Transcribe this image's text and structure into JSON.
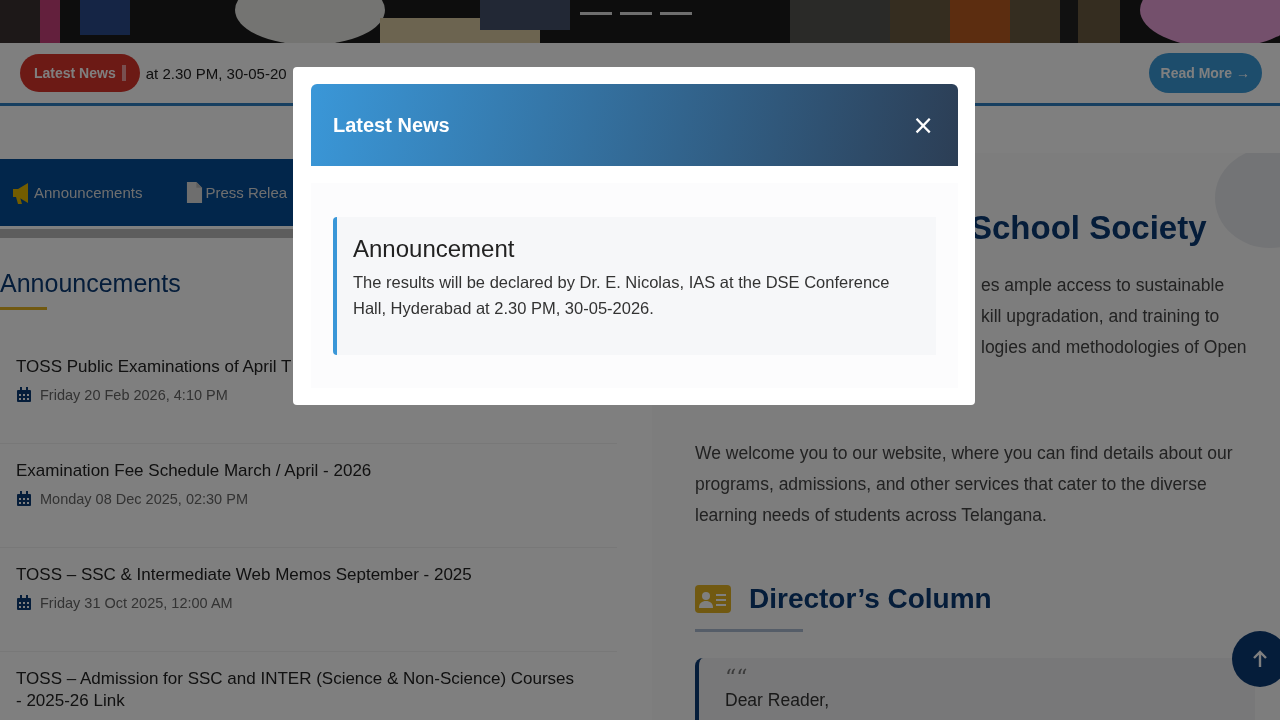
{
  "ticker": {
    "badge": "Latest News",
    "text": "at 2.30 PM, 30-05-20",
    "button": "Read More →"
  },
  "tabs": [
    {
      "label": "Announcements"
    },
    {
      "label": "Press Relea"
    }
  ],
  "announcements": {
    "heading": "Announcements",
    "items": [
      {
        "title": "TOSS Public Examinations of April T",
        "date": "Friday 20 Feb 2026, 4:10 PM"
      },
      {
        "title": "Examination Fee Schedule March / April - 2026",
        "date": "Monday 08 Dec 2025, 02:30 PM"
      },
      {
        "title": "TOSS – SSC & Intermediate Web Memos September - 2025",
        "date": "Friday 31 Oct 2025, 12:00 AM"
      },
      {
        "title": "TOSS – Admission for SSC and INTER (Science & Non-Science) Courses - 2025-26 Link"
      }
    ]
  },
  "about": {
    "heading": "School Society",
    "lines": [
      "es ample access to sustainable",
      "kill upgradation, and training to",
      "logies and methodologies of Open"
    ],
    "welcome": "We welcome you to our website, where you can find details about our programs, admissions, and other services that cater to the diverse learning needs of students across Telangana."
  },
  "director": {
    "heading": "Director’s Column",
    "quote_mark": "““",
    "greeting": "Dear Reader,"
  },
  "modal": {
    "title": "Latest News",
    "close": "×",
    "card_title": "Announcement",
    "card_text": "The results will be declared by Dr. E. Nicolas, IAS at the DSE Conference Hall, Hyderabad at 2.30 PM, 30-05-2026."
  }
}
